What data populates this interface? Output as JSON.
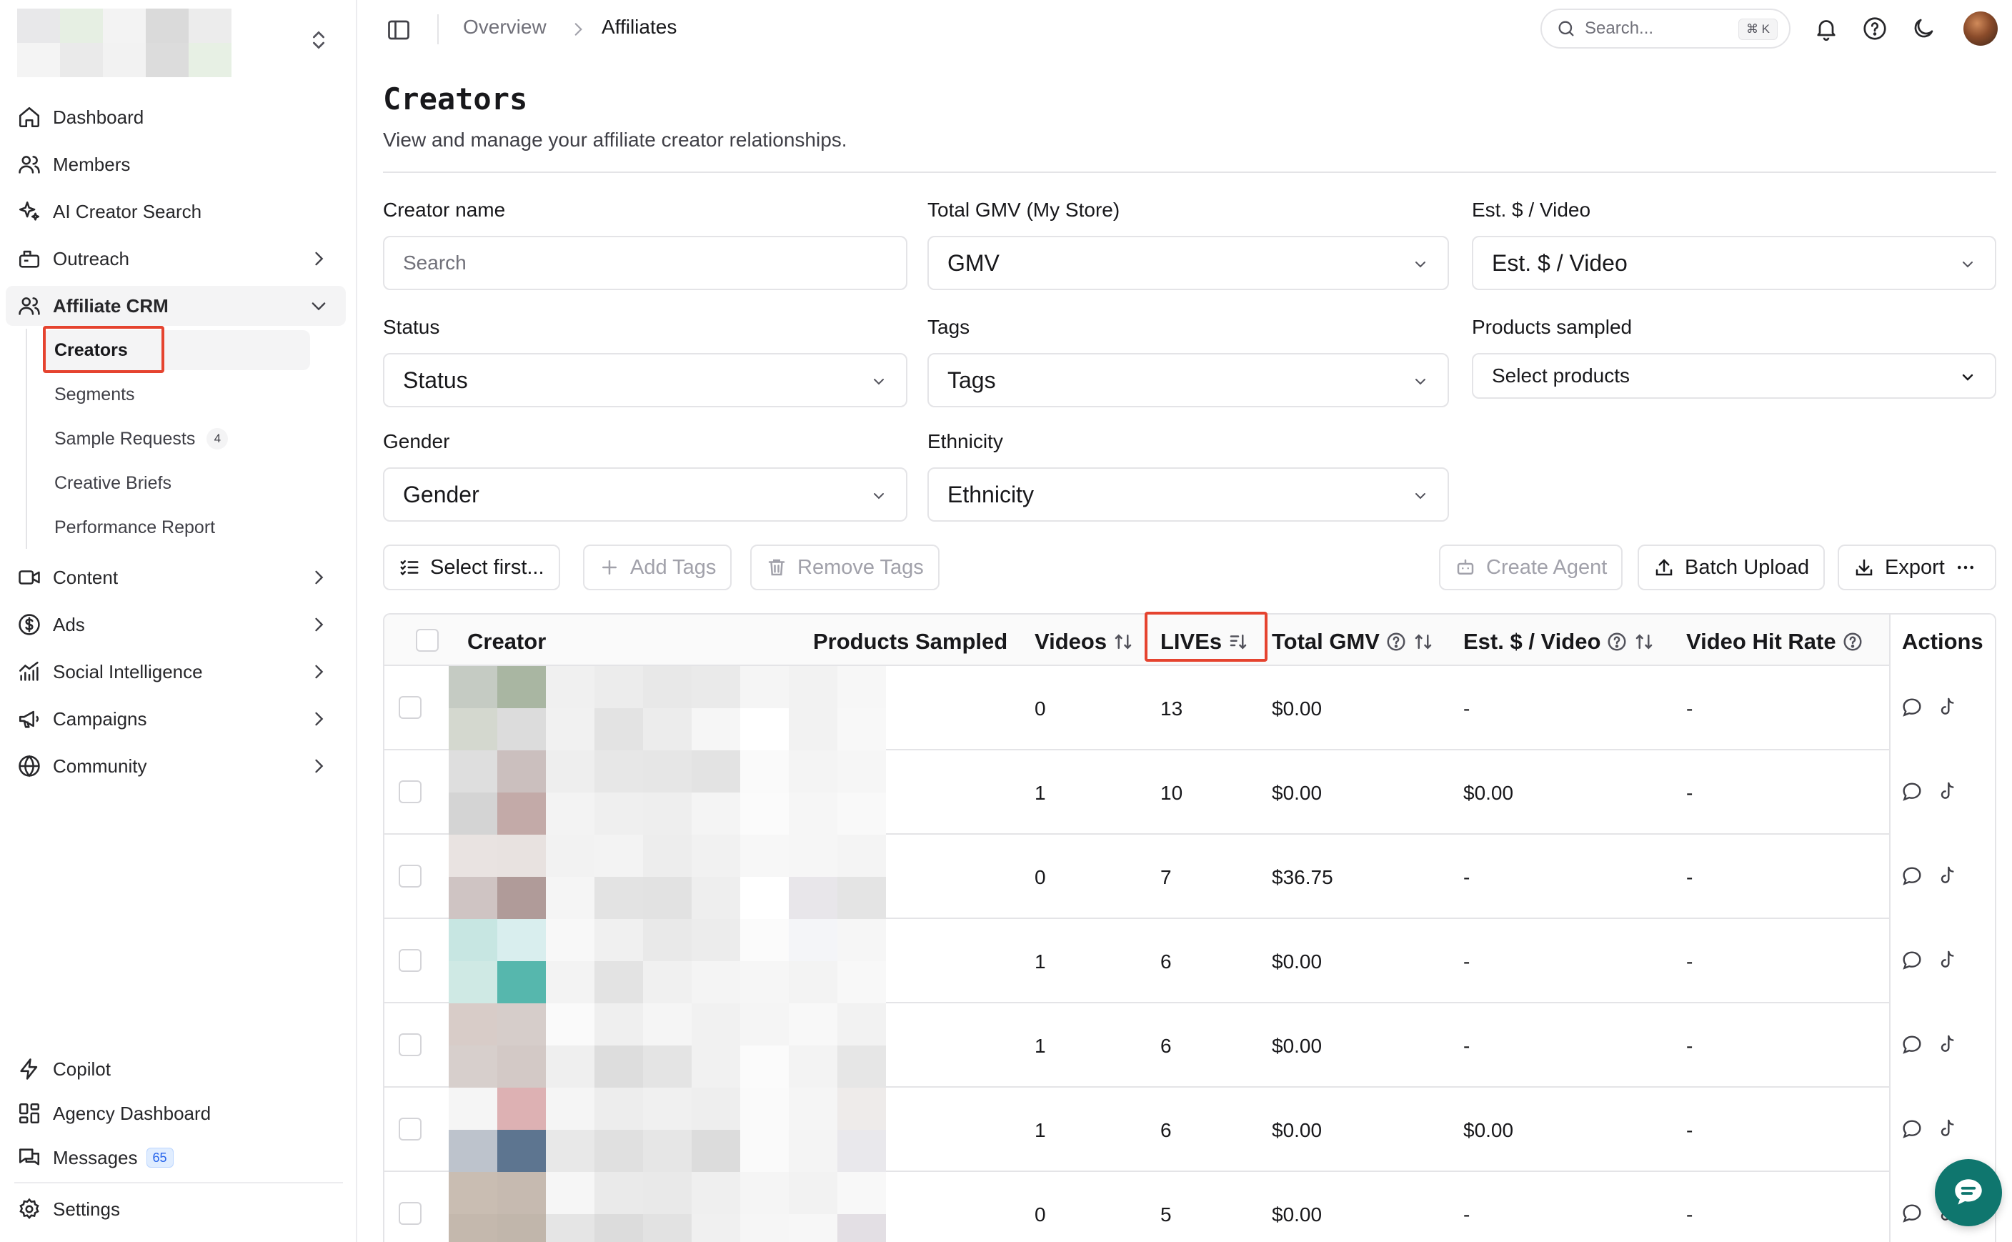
{
  "sidebar": {
    "nav": [
      {
        "label": "Dashboard",
        "icon": "home-icon"
      },
      {
        "label": "Members",
        "icon": "users-icon"
      },
      {
        "label": "AI Creator Search",
        "icon": "sparkles-icon"
      },
      {
        "label": "Outreach",
        "icon": "mailbox-icon"
      },
      {
        "label": "Affiliate CRM",
        "icon": "contacts-icon"
      }
    ],
    "crm_sub": [
      {
        "label": "Creators"
      },
      {
        "label": "Segments"
      },
      {
        "label": "Sample Requests",
        "badge": "4"
      },
      {
        "label": "Creative Briefs"
      },
      {
        "label": "Performance Report"
      }
    ],
    "nav2": [
      {
        "label": "Content",
        "icon": "video-icon"
      },
      {
        "label": "Ads",
        "icon": "dollar-icon"
      },
      {
        "label": "Social Intelligence",
        "icon": "chart-icon"
      },
      {
        "label": "Campaigns",
        "icon": "megaphone-icon"
      },
      {
        "label": "Community",
        "icon": "globe-icon"
      }
    ],
    "bottom": [
      {
        "label": "Copilot",
        "icon": "bolt-icon"
      },
      {
        "label": "Agency Dashboard",
        "icon": "grid-icon"
      },
      {
        "label": "Messages",
        "icon": "messages-icon",
        "badge": "65"
      },
      {
        "label": "Settings",
        "icon": "gear-icon"
      }
    ]
  },
  "topbar": {
    "breadcrumb": [
      "Overview",
      "Affiliates"
    ],
    "search_placeholder": "Search...",
    "search_shortcut": "⌘ K"
  },
  "page": {
    "title": "Creators",
    "subtitle": "View and manage your affiliate creator relationships."
  },
  "filters": {
    "creator_name": {
      "label": "Creator name",
      "placeholder": "Search"
    },
    "total_gmv": {
      "label": "Total GMV (My Store)",
      "value": "GMV"
    },
    "est_video": {
      "label": "Est. $ / Video",
      "value": "Est. $ / Video"
    },
    "status": {
      "label": "Status",
      "value": "Status"
    },
    "tags": {
      "label": "Tags",
      "value": "Tags"
    },
    "products_sampled": {
      "label": "Products sampled",
      "value": "Select products"
    },
    "gender": {
      "label": "Gender",
      "value": "Gender"
    },
    "ethnicity": {
      "label": "Ethnicity",
      "value": "Ethnicity"
    }
  },
  "toolbar": {
    "select_first": "Select first...",
    "add_tags": "Add Tags",
    "remove_tags": "Remove Tags",
    "create_agent": "Create Agent",
    "batch_upload": "Batch Upload",
    "export": "Export"
  },
  "table": {
    "columns": [
      "Creator",
      "Products Sampled",
      "Videos",
      "LIVEs",
      "Total GMV",
      "Est. $ / Video",
      "Video Hit Rate",
      "Actions"
    ],
    "rows": [
      {
        "videos": "0",
        "lives": "13",
        "gmv": "$0.00",
        "est": "-",
        "hit": "-"
      },
      {
        "videos": "1",
        "lives": "10",
        "gmv": "$0.00",
        "est": "$0.00",
        "hit": "-"
      },
      {
        "videos": "0",
        "lives": "7",
        "gmv": "$36.75",
        "est": "-",
        "hit": "-"
      },
      {
        "videos": "1",
        "lives": "6",
        "gmv": "$0.00",
        "est": "-",
        "hit": "-"
      },
      {
        "videos": "1",
        "lives": "6",
        "gmv": "$0.00",
        "est": "-",
        "hit": "-"
      },
      {
        "videos": "1",
        "lives": "6",
        "gmv": "$0.00",
        "est": "$0.00",
        "hit": "-"
      },
      {
        "videos": "0",
        "lives": "5",
        "gmv": "$0.00",
        "est": "-",
        "hit": "-"
      }
    ]
  },
  "colors": {
    "highlight": "#e5432f",
    "accent_fab": "#0f766e",
    "badge_blue": "#2563eb"
  }
}
